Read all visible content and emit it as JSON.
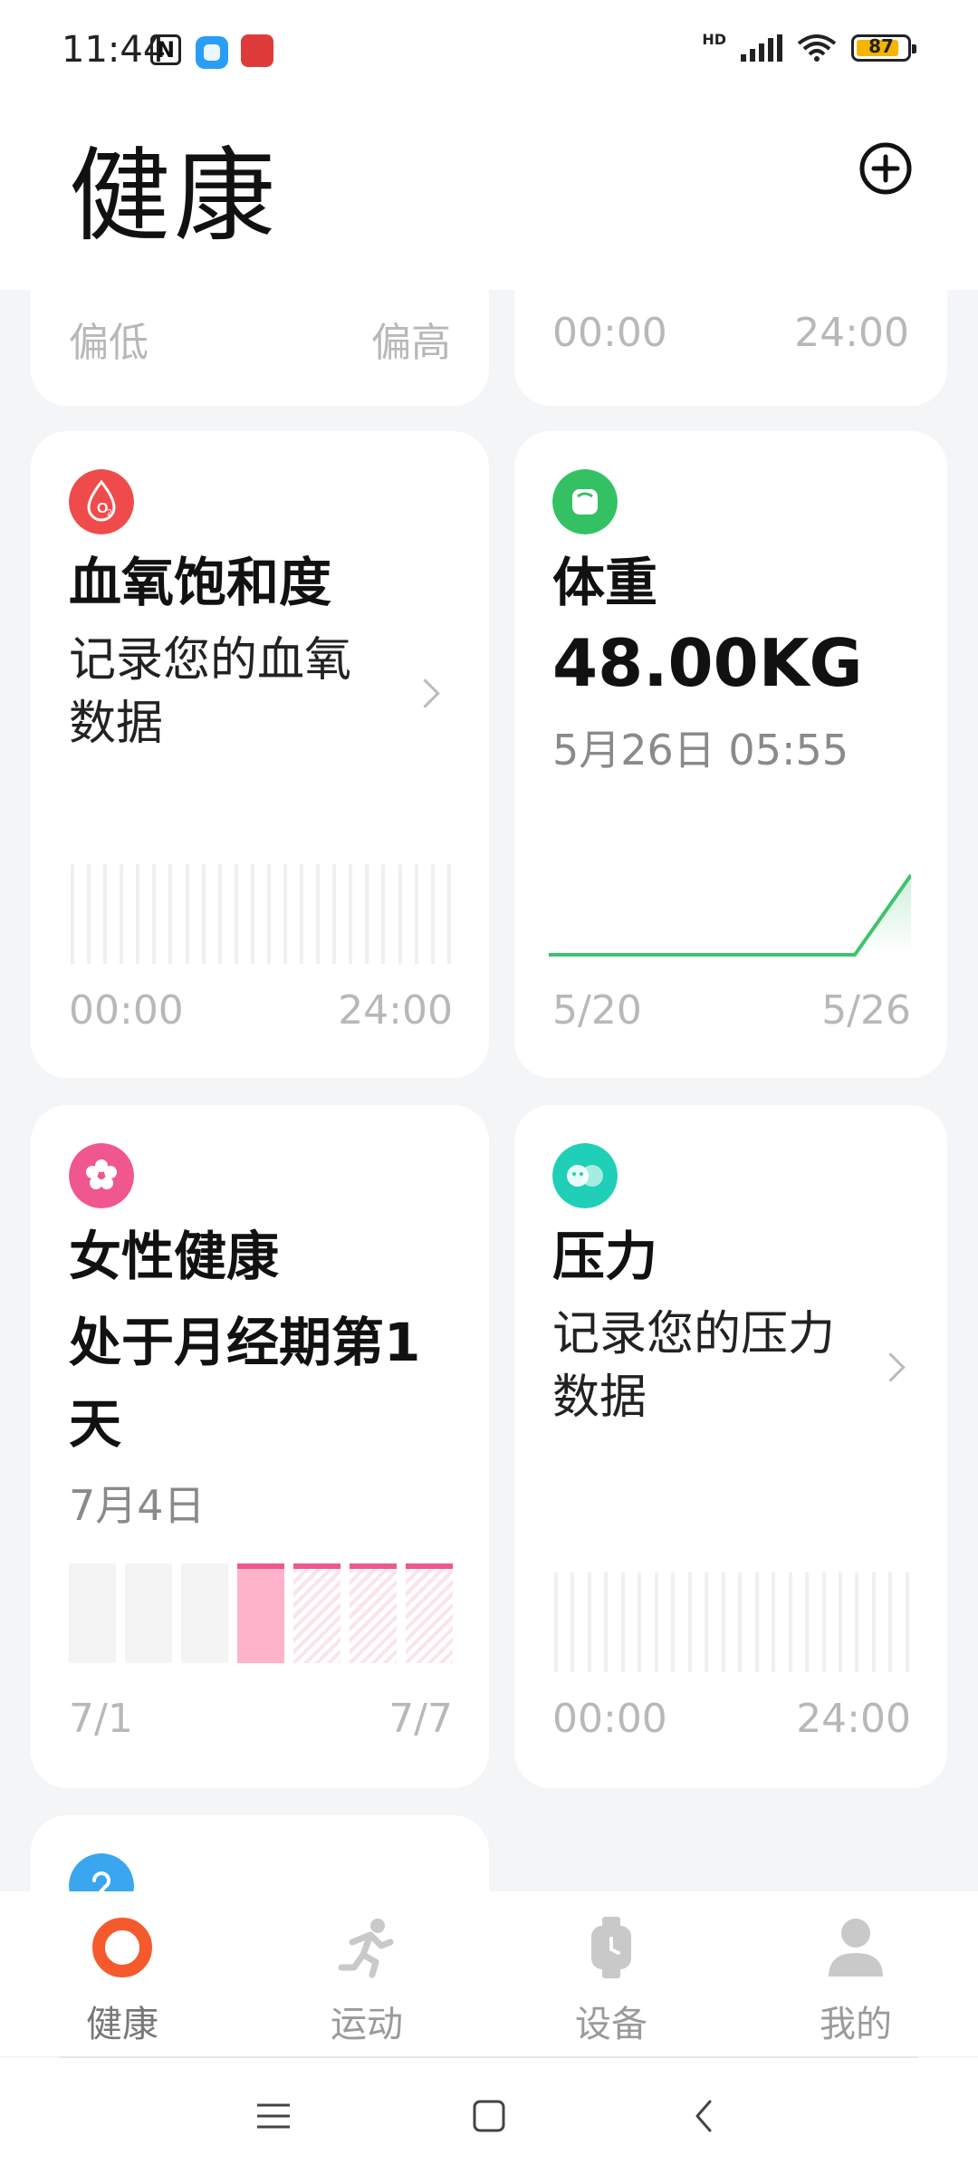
{
  "status": {
    "time": "11:44",
    "hd": "HD",
    "battery": "87"
  },
  "header": {
    "title": "健康"
  },
  "cards": {
    "partial_left": {
      "low": "偏低",
      "high": "偏高"
    },
    "partial_right": {
      "start": "00:00",
      "end": "24:00"
    },
    "spo2": {
      "title": "血氧饱和度",
      "subtitle": "记录您的血氧数据",
      "axis_start": "00:00",
      "axis_end": "24:00"
    },
    "weight": {
      "title": "体重",
      "value": "48.00KG",
      "date": "5月26日 05:55",
      "axis_start": "5/20",
      "axis_end": "5/26"
    },
    "female": {
      "title": "女性健康",
      "status": "处于月经期第1天",
      "date": "7月4日",
      "axis_start": "7/1",
      "axis_end": "7/7"
    },
    "stress": {
      "title": "压力",
      "subtitle": "记录您的压力数据",
      "axis_start": "00:00",
      "axis_end": "24:00"
    }
  },
  "nav": {
    "health": "健康",
    "sports": "运动",
    "devices": "设备",
    "me": "我的"
  },
  "colors": {
    "weight_line": "#3ec46d",
    "female_accent": "#f0578f",
    "health_active": "#f55a2c"
  }
}
